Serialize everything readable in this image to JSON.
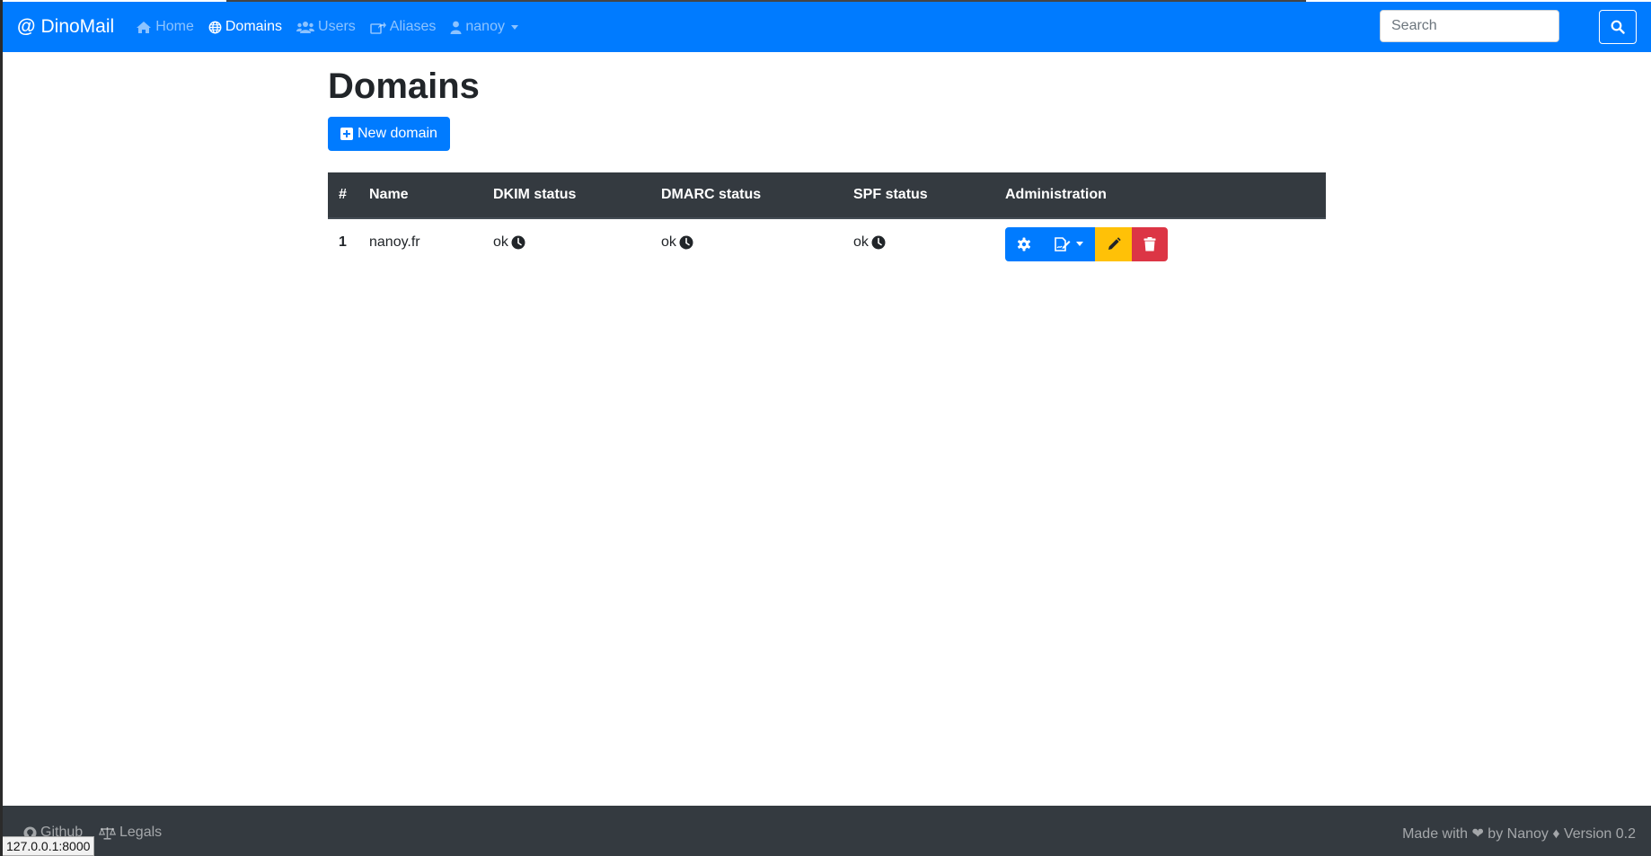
{
  "navbar": {
    "brand": "DinoMail",
    "items": [
      {
        "label": "Home",
        "icon": "home-icon"
      },
      {
        "label": "Domains",
        "icon": "globe-icon"
      },
      {
        "label": "Users",
        "icon": "users-icon"
      },
      {
        "label": "Aliases",
        "icon": "share-icon"
      },
      {
        "label": "nanoy",
        "icon": "user-icon"
      }
    ],
    "search": {
      "placeholder": "Search",
      "value": ""
    }
  },
  "page": {
    "title": "Domains",
    "new_button": "New domain"
  },
  "table": {
    "headers": [
      "#",
      "Name",
      "DKIM status",
      "DMARC status",
      "SPF status",
      "Administration"
    ],
    "rows": [
      {
        "id": "1",
        "name": "nanoy.fr",
        "dkim": "ok",
        "dmarc": "ok",
        "spf": "ok"
      }
    ]
  },
  "footer": {
    "github": "Github",
    "legals": "Legals",
    "credit": "Made with ❤ by Nanoy ♦ Version 0.2"
  },
  "status_url": "127.0.0.1:8000",
  "colors": {
    "primary": "#007bff",
    "dark": "#343a40",
    "warning": "#ffc107",
    "danger": "#dc3545"
  }
}
